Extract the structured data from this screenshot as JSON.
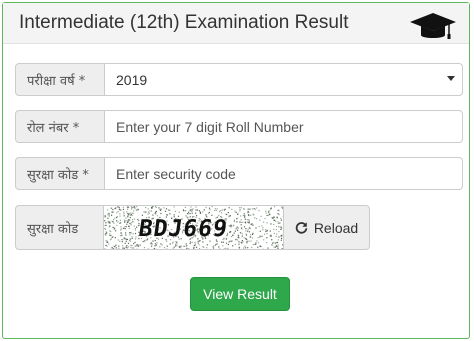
{
  "panel": {
    "title": "Intermediate (12th) Examination Result",
    "title_icon": "graduation-cap-icon"
  },
  "form": {
    "year": {
      "label": "परीक्षा वर्ष *",
      "selected": "2019"
    },
    "roll": {
      "label": "रोल नंबर *",
      "placeholder": "Enter your 7 digit Roll Number"
    },
    "security": {
      "label": "सुरक्षा कोड *",
      "placeholder": "Enter security code"
    },
    "captcha": {
      "label": "सुरक्षा कोड",
      "code": "BDJ669",
      "reload_label": "Reload",
      "reload_icon": "refresh-icon"
    },
    "submit_label": "View Result"
  },
  "colors": {
    "accent": "#2ea84a",
    "panel_border": "#5cb85c"
  }
}
